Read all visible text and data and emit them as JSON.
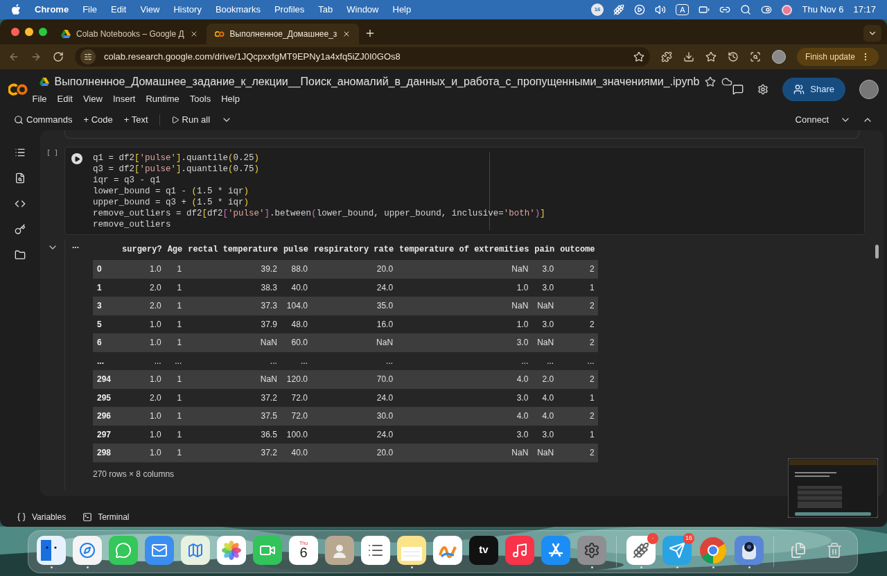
{
  "menubar": {
    "app": "Chrome",
    "items": [
      "File",
      "Edit",
      "View",
      "History",
      "Bookmarks",
      "Profiles",
      "Tab",
      "Window",
      "Help"
    ],
    "status_badge": "16",
    "input_source": "A",
    "date": "Thu Nov 6",
    "time": "17:17"
  },
  "browser_tabs": [
    {
      "title": "Colab Notebooks – Google Д",
      "selected": false
    },
    {
      "title": "Выполненное_Домашнее_з",
      "selected": true
    }
  ],
  "address": {
    "url": "colab.research.google.com/drive/1JQcpxxfgMT9EPNy1a4xfq5iZJ0I0GOs8",
    "update_button": "Finish update"
  },
  "notebook": {
    "title": "Выполненное_Домашнее_задание_к_лекции__Поиск_аномалий_в_данных_и_работа_с_пропущенными_значениями_.ipynb",
    "menu": [
      "File",
      "Edit",
      "View",
      "Insert",
      "Runtime",
      "Tools",
      "Help"
    ],
    "share": "Share"
  },
  "toolbar": {
    "commands": "Commands",
    "add_code": "+ Code",
    "add_text": "+ Text",
    "run_all": "Run all",
    "connect": "Connect"
  },
  "cell": {
    "execution_count": "[ ]",
    "output_menu": "...",
    "code": [
      [
        {
          "kind": "plain",
          "t": "q1 = df2"
        },
        {
          "kind": "bracket",
          "t": "["
        },
        {
          "kind": "string",
          "t": "'pulse'"
        },
        {
          "kind": "bracket",
          "t": "]"
        },
        {
          "kind": "plain",
          "t": ".quantile"
        },
        {
          "kind": "bracket",
          "t": "("
        },
        {
          "kind": "plain",
          "t": "0.25"
        },
        {
          "kind": "bracket",
          "t": ")"
        }
      ],
      [
        {
          "kind": "plain",
          "t": "q3 = df2"
        },
        {
          "kind": "bracket",
          "t": "["
        },
        {
          "kind": "string",
          "t": "'pulse'"
        },
        {
          "kind": "bracket",
          "t": "]"
        },
        {
          "kind": "plain",
          "t": ".quantile"
        },
        {
          "kind": "bracket",
          "t": "("
        },
        {
          "kind": "plain",
          "t": "0.75"
        },
        {
          "kind": "bracket",
          "t": ")"
        }
      ],
      [
        {
          "kind": "plain",
          "t": "iqr = q3 - q1"
        }
      ],
      [
        {
          "kind": "plain",
          "t": "lower_bound = q1 - "
        },
        {
          "kind": "bracket",
          "t": "("
        },
        {
          "kind": "plain",
          "t": "1.5 * iqr"
        },
        {
          "kind": "bracket",
          "t": ")"
        }
      ],
      [
        {
          "kind": "plain",
          "t": "upper_bound = q3 + "
        },
        {
          "kind": "bracket",
          "t": "("
        },
        {
          "kind": "plain",
          "t": "1.5 * iqr"
        },
        {
          "kind": "bracket",
          "t": ")"
        }
      ],
      [
        {
          "kind": "plain",
          "t": "remove_outliers = df2"
        },
        {
          "kind": "bracket",
          "t": "["
        },
        {
          "kind": "plain",
          "t": "df2"
        },
        {
          "kind": "inner",
          "t": "["
        },
        {
          "kind": "string",
          "t": "'pulse'"
        },
        {
          "kind": "inner",
          "t": "]"
        },
        {
          "kind": "plain",
          "t": ".between"
        },
        {
          "kind": "inner",
          "t": "("
        },
        {
          "kind": "plain",
          "t": "lower_bound, upper_bound, inclusive="
        },
        {
          "kind": "string",
          "t": "'both'"
        },
        {
          "kind": "inner",
          "t": ")"
        },
        {
          "kind": "bracket",
          "t": "]"
        }
      ],
      [
        {
          "kind": "plain",
          "t": "remove_outliers"
        }
      ]
    ]
  },
  "table": {
    "columns": [
      "surgery?",
      "Age",
      "rectal temperature",
      "pulse",
      "respiratory rate",
      "temperature of extremities",
      "pain",
      "outcome"
    ],
    "rows": [
      {
        "index": "0",
        "cells": [
          "1.0",
          "1",
          "39.2",
          "88.0",
          "20.0",
          "NaN",
          "3.0",
          "2"
        ]
      },
      {
        "index": "1",
        "cells": [
          "2.0",
          "1",
          "38.3",
          "40.0",
          "24.0",
          "1.0",
          "3.0",
          "1"
        ]
      },
      {
        "index": "3",
        "cells": [
          "2.0",
          "1",
          "37.3",
          "104.0",
          "35.0",
          "NaN",
          "NaN",
          "2"
        ]
      },
      {
        "index": "5",
        "cells": [
          "1.0",
          "1",
          "37.9",
          "48.0",
          "16.0",
          "1.0",
          "3.0",
          "2"
        ]
      },
      {
        "index": "6",
        "cells": [
          "1.0",
          "1",
          "NaN",
          "60.0",
          "NaN",
          "3.0",
          "NaN",
          "2"
        ]
      },
      {
        "index": "...",
        "cells": [
          "...",
          "...",
          "...",
          "...",
          "...",
          "...",
          "...",
          "..."
        ]
      },
      {
        "index": "294",
        "cells": [
          "1.0",
          "1",
          "NaN",
          "120.0",
          "70.0",
          "4.0",
          "2.0",
          "2"
        ]
      },
      {
        "index": "295",
        "cells": [
          "2.0",
          "1",
          "37.2",
          "72.0",
          "24.0",
          "3.0",
          "4.0",
          "1"
        ]
      },
      {
        "index": "296",
        "cells": [
          "1.0",
          "1",
          "37.5",
          "72.0",
          "30.0",
          "4.0",
          "4.0",
          "2"
        ]
      },
      {
        "index": "297",
        "cells": [
          "1.0",
          "1",
          "36.5",
          "100.0",
          "24.0",
          "3.0",
          "3.0",
          "1"
        ]
      },
      {
        "index": "298",
        "cells": [
          "1.0",
          "1",
          "37.2",
          "40.0",
          "20.0",
          "NaN",
          "NaN",
          "2"
        ]
      }
    ],
    "shape": "270 rows × 8 columns"
  },
  "bottom_bar": [
    "Variables",
    "Terminal"
  ],
  "dock": [
    {
      "kind": "finder",
      "running": true
    },
    {
      "kind": "safari",
      "running": true
    },
    {
      "kind": "messages",
      "running": false
    },
    {
      "kind": "mail",
      "running": false
    },
    {
      "kind": "maps",
      "running": false
    },
    {
      "kind": "photos",
      "running": false
    },
    {
      "kind": "facetime",
      "running": false
    },
    {
      "kind": "calendar",
      "running": false,
      "day": "Thu",
      "date": "6"
    },
    {
      "kind": "contacts",
      "running": false
    },
    {
      "kind": "reminders",
      "running": false
    },
    {
      "kind": "notes",
      "running": true
    },
    {
      "kind": "freeform",
      "running": false
    },
    {
      "kind": "tv",
      "running": false,
      "label": "tv"
    },
    {
      "kind": "music",
      "running": false
    },
    {
      "kind": "appstore",
      "running": false
    },
    {
      "kind": "settings",
      "running": true
    },
    {
      "kind": "divider"
    },
    {
      "kind": "wheat",
      "running": true,
      "badge": "·"
    },
    {
      "kind": "telegram",
      "running": true,
      "badge": "16"
    },
    {
      "kind": "chrome",
      "running": true
    },
    {
      "kind": "lens",
      "running": true
    },
    {
      "kind": "divider"
    },
    {
      "kind": "documents",
      "running": false
    },
    {
      "kind": "trash",
      "running": false
    }
  ]
}
